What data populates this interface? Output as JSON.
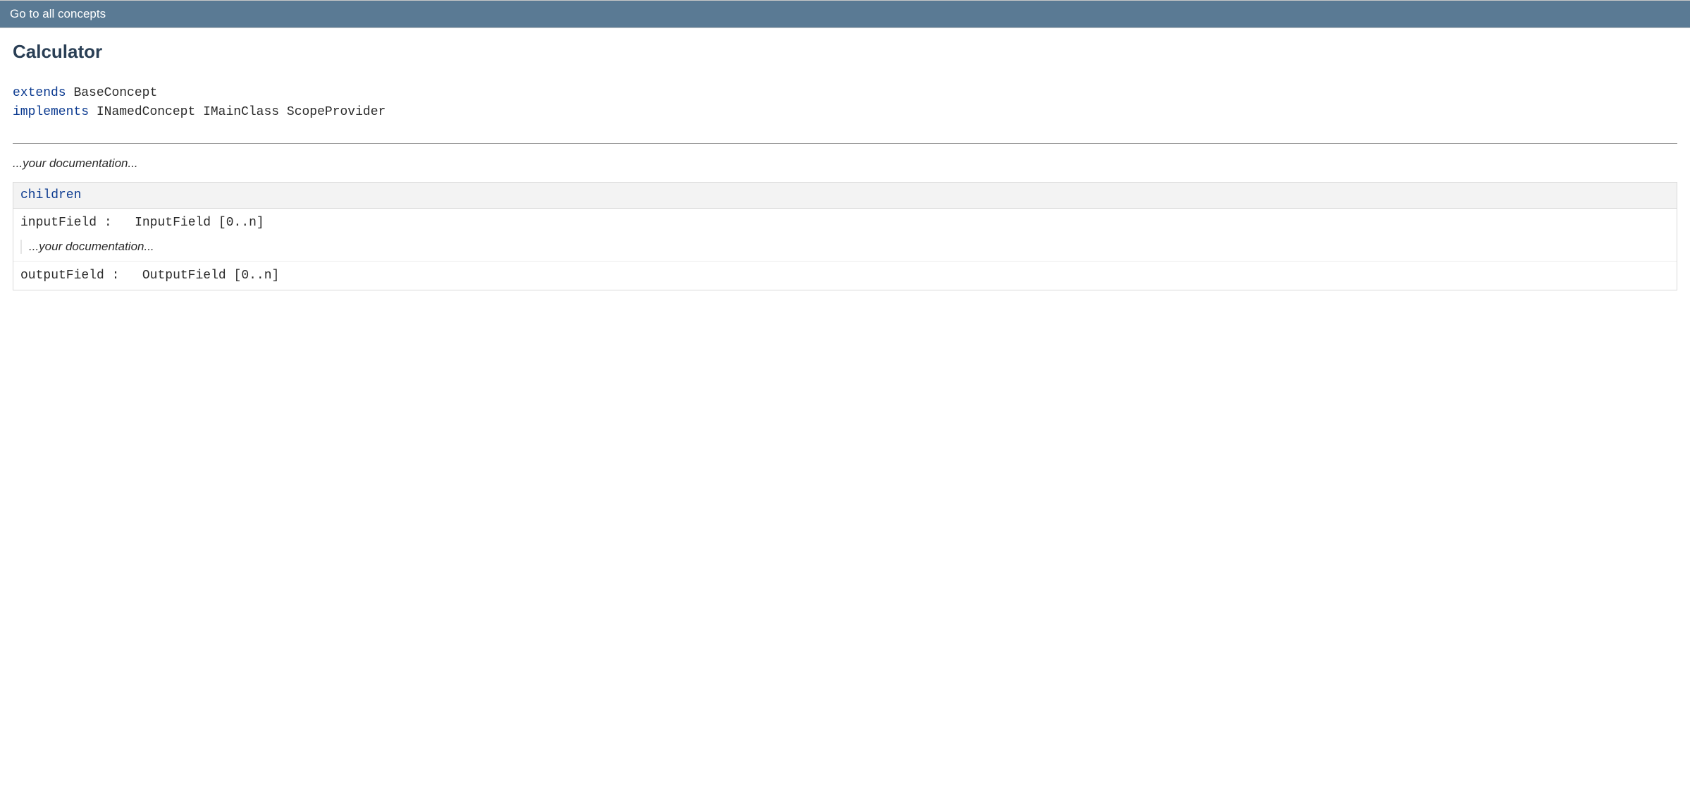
{
  "nav": {
    "back_link": "Go to all concepts"
  },
  "concept": {
    "title": "Calculator",
    "extends_kw": "extends",
    "extends_target": "BaseConcept",
    "implements_kw": "implements",
    "implements_list": "INamedConcept IMainClass ScopeProvider",
    "doc_placeholder": "...your documentation..."
  },
  "children_section": {
    "header": "children",
    "rows": [
      {
        "name": "inputField",
        "sep": ":",
        "type": "InputField",
        "card": "[0..n]",
        "doc_placeholder": "...your documentation..."
      },
      {
        "name": "outputField",
        "sep": ":",
        "type": "OutputField",
        "card": "[0..n]"
      }
    ]
  }
}
